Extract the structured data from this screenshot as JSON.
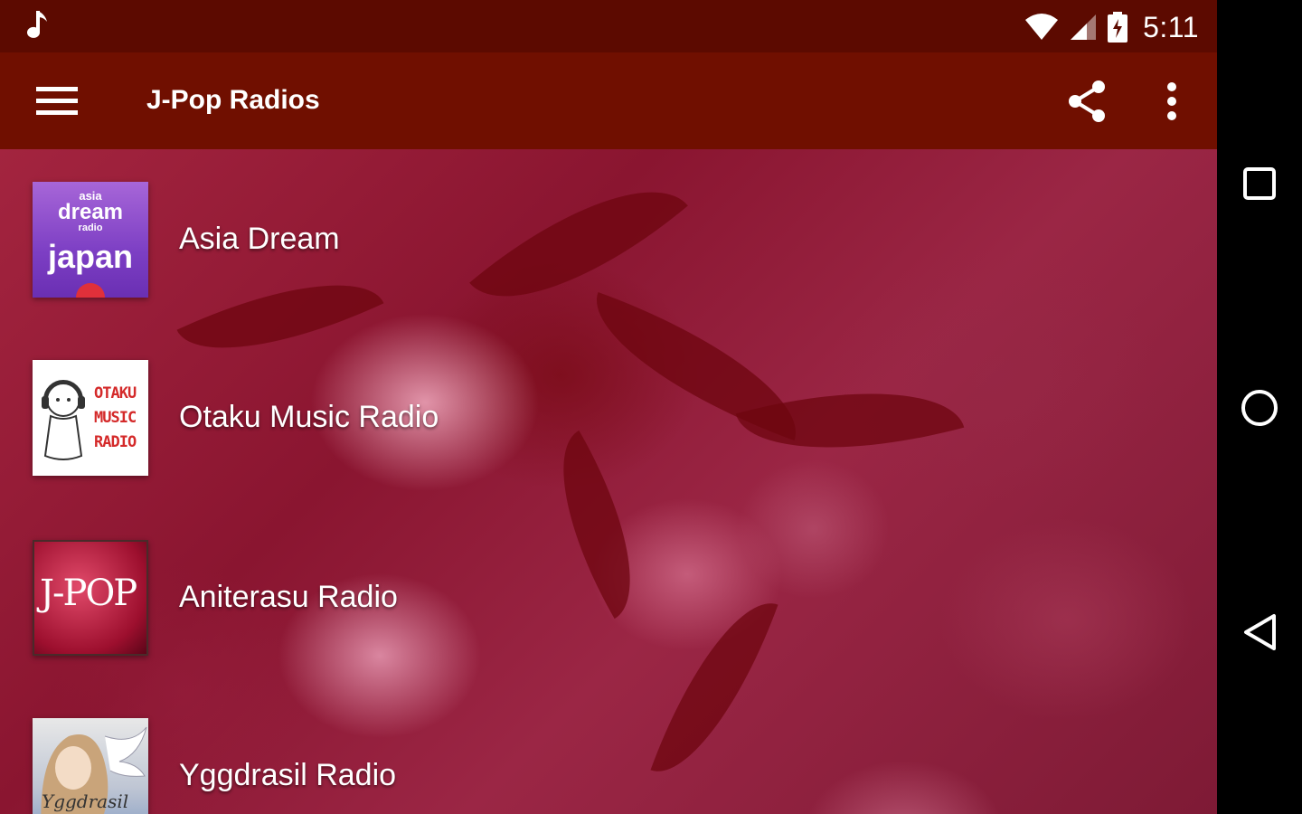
{
  "status_bar": {
    "time": "5:11",
    "icons": [
      "music-note-icon",
      "wifi-icon",
      "signal-icon",
      "battery-charging-icon"
    ]
  },
  "toolbar": {
    "title": "J-Pop Radios",
    "icons": [
      "menu-icon",
      "share-icon",
      "more-vert-icon"
    ]
  },
  "stations": [
    {
      "name": "Asia Dream",
      "logo_text": [
        "asia",
        "dream",
        "radio",
        "japan"
      ]
    },
    {
      "name": "Otaku Music Radio",
      "logo_text": [
        "OTAKU",
        "MUSIC",
        "RADIO"
      ]
    },
    {
      "name": "Aniterasu Radio",
      "logo_text": [
        "J-POP"
      ]
    },
    {
      "name": "Yggdrasil Radio",
      "logo_text": [
        "Yggdrasil"
      ]
    }
  ],
  "nav_bar": {
    "icons": [
      "recents-square-icon",
      "home-circle-icon",
      "back-triangle-icon"
    ]
  },
  "colors": {
    "status_bar": "#5c0a00",
    "toolbar": "#700f00",
    "background_tint": "#9b2645",
    "nav_bar": "#000000"
  }
}
